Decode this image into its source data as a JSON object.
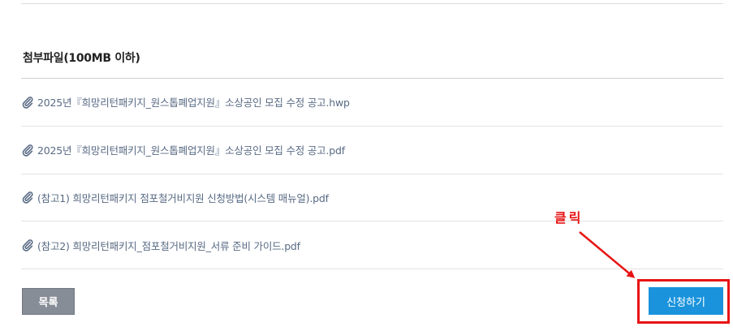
{
  "attachments": {
    "title": "첨부파일(100MB 이하)",
    "files": [
      {
        "name": "2025년『희망리턴패키지_원스톱폐업지원』소상공인 모집 수정 공고.hwp",
        "icon": "paperclip-icon"
      },
      {
        "name": "2025년『희망리턴패키지_원스톱폐업지원』소상공인 모집 수정 공고.pdf",
        "icon": "paperclip-icon"
      },
      {
        "name": "(참고1) 희망리턴패키지 점포철거비지원 신청방법(시스템 매뉴얼).pdf",
        "icon": "paperclip-icon"
      },
      {
        "name": "(참고2) 희망리턴패키지_점포철거비지원_서류 준비 가이드.pdf",
        "icon": "paperclip-icon"
      }
    ]
  },
  "actions": {
    "list_label": "목록",
    "apply_label": "신청하기"
  },
  "annotation": {
    "label": "클릭",
    "color": "#e81414"
  },
  "colors": {
    "apply_button": "#1a93dc",
    "list_button": "#878d96",
    "file_link": "#586a84"
  }
}
